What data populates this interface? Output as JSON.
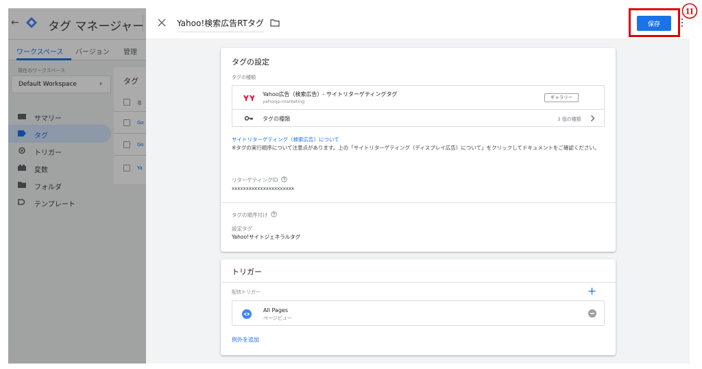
{
  "background_app": {
    "title": "タグ マネージャー",
    "tabs": [
      {
        "label": "ワークスペース"
      },
      {
        "label": "バージョン"
      },
      {
        "label": "管理"
      }
    ],
    "workspace_label": "現在のワークスペース",
    "workspace_name": "Default Workspace",
    "nav": [
      {
        "label": "サマリー"
      },
      {
        "label": "タグ"
      },
      {
        "label": "トリガー"
      },
      {
        "label": "変数"
      },
      {
        "label": "フォルダ"
      },
      {
        "label": "テンプレート"
      }
    ],
    "panel": {
      "title": "タグ",
      "header_cell": "名",
      "rows": [
        "Go",
        "Go",
        "Ya"
      ]
    }
  },
  "drawer": {
    "title": "Yahoo!検索広告RTタグ",
    "save_label": "保存",
    "tag_config": {
      "heading": "タグの設定",
      "type_label": "タグの種類",
      "template_name": "Yahoo広告（検索広告）- サイトリターゲティングタグ",
      "template_vendor": "yahoojp-marketing",
      "gallery_label": "ギャラリー",
      "tag_type_row": "タグの種類",
      "tag_type_count": "3 個の種類",
      "about_link": "サイトリターゲティング（検索広告）について",
      "note": "※タグの実行順序について注意点があります。上の「サイトリターゲティング（ディスプレイ広告）について」をクリックしてドキュメントをご確認ください。",
      "retargeting_id_label": "リターゲティングID",
      "retargeting_id_value": "xxxxxxxxxxxxxxxxxxxxxx",
      "sequencing_label": "タグの順序付け",
      "setup_tag_label": "設定タグ",
      "setup_tag_value": "Yahoo!サイトジェネラルタグ"
    },
    "trigger": {
      "heading": "トリガー",
      "firing_label": "配信トリガー",
      "item_name": "All Pages",
      "item_type": "ページビュー",
      "add_exception": "例外を追加"
    }
  },
  "annotation": {
    "step": "⑪"
  },
  "colors": {
    "accent": "#1a73e8",
    "callout": "#e00000",
    "drawer_bg": "#f1f3f4",
    "yahoo_red": "#ff0033"
  },
  "icons": [
    "back-arrow-icon",
    "gtm-logo-icon",
    "close-icon",
    "folder-icon",
    "more-vert-icon",
    "yahoo-logo-icon",
    "key-icon",
    "chevron-right-icon",
    "help-icon",
    "plus-icon",
    "eye-icon",
    "remove-icon"
  ]
}
